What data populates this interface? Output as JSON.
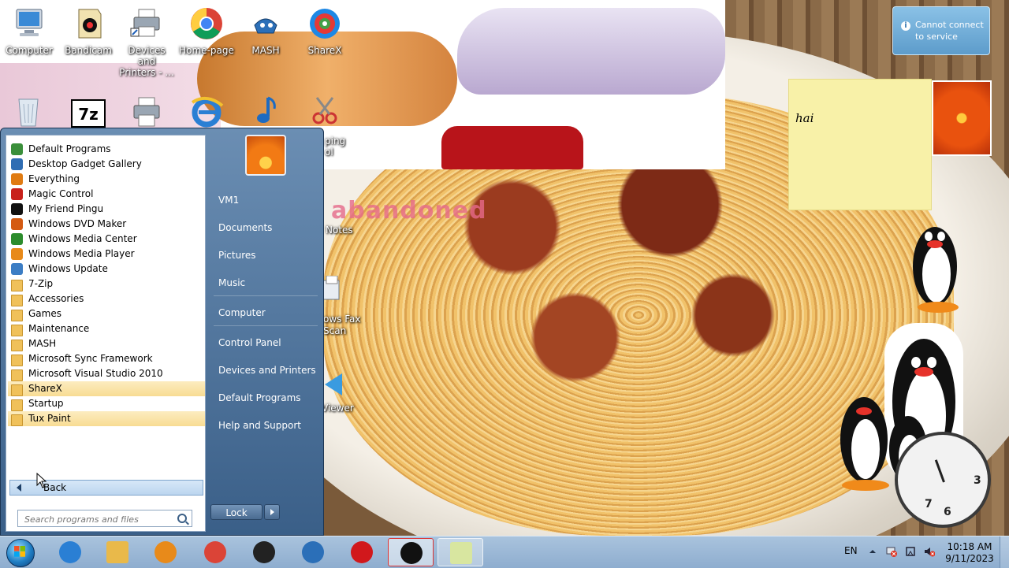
{
  "desktop": {
    "icons": [
      {
        "label": "Computer",
        "icon": "computer-icon"
      },
      {
        "label": "Bandicam",
        "icon": "bandicam-icon"
      },
      {
        "label": "Devices and Printers - ...",
        "icon": "printer-icon"
      },
      {
        "label": "Home-page",
        "icon": "chrome-icon"
      },
      {
        "label": "MASH",
        "icon": "mash-icon"
      },
      {
        "label": "ShareX",
        "icon": "sharex-icon"
      }
    ],
    "second_row_icons": [
      "recycle-bin-icon",
      "7zip-icon",
      "printer-icon",
      "internet-explorer-icon",
      "music-icon",
      "snipping-tool-icon"
    ],
    "partial_labels": {
      "snipping": "ping",
      "snipping2": "ol",
      "notes": "Notes",
      "fax": "ows Fax",
      "scan": "Scan",
      "viewer": "Viewer"
    },
    "wallpaper_watermark": "abandoned"
  },
  "gadgets": {
    "notification": {
      "line1": "Cannot connect",
      "line2": "to service"
    },
    "sticky_note": "hai",
    "clock_numbers": [
      "3",
      "6",
      "7"
    ]
  },
  "start_menu": {
    "programs": [
      {
        "label": "Default Programs",
        "icon": "default-programs-icon",
        "color": "#3a8f3a",
        "folder": false,
        "highlight": false
      },
      {
        "label": "Desktop Gadget Gallery",
        "icon": "gadget-gallery-icon",
        "color": "#2f6db3",
        "folder": false,
        "highlight": false
      },
      {
        "label": "Everything",
        "icon": "everything-search-icon",
        "color": "#e07b12",
        "folder": false,
        "highlight": false
      },
      {
        "label": "Magic Control",
        "icon": "magic-control-icon",
        "color": "#c8211b",
        "folder": false,
        "highlight": false
      },
      {
        "label": "My Friend Pingu",
        "icon": "pingu-icon",
        "color": "#111111",
        "folder": false,
        "highlight": false
      },
      {
        "label": "Windows DVD Maker",
        "icon": "dvd-maker-icon",
        "color": "#d45a12",
        "folder": false,
        "highlight": false
      },
      {
        "label": "Windows Media Center",
        "icon": "media-center-icon",
        "color": "#2c8c2c",
        "folder": false,
        "highlight": false
      },
      {
        "label": "Windows Media Player",
        "icon": "media-player-icon",
        "color": "#e88a1a",
        "folder": false,
        "highlight": false
      },
      {
        "label": "Windows Update",
        "icon": "windows-update-icon",
        "color": "#3c7dc4",
        "folder": false,
        "highlight": false
      },
      {
        "label": "7-Zip",
        "icon": "folder-icon",
        "folder": true,
        "highlight": false
      },
      {
        "label": "Accessories",
        "icon": "folder-icon",
        "folder": true,
        "highlight": false
      },
      {
        "label": "Games",
        "icon": "folder-icon",
        "folder": true,
        "highlight": false
      },
      {
        "label": "Maintenance",
        "icon": "folder-icon",
        "folder": true,
        "highlight": false
      },
      {
        "label": "MASH",
        "icon": "folder-icon",
        "folder": true,
        "highlight": false
      },
      {
        "label": "Microsoft Sync Framework",
        "icon": "folder-icon",
        "folder": true,
        "highlight": false
      },
      {
        "label": "Microsoft Visual Studio 2010",
        "icon": "folder-icon",
        "folder": true,
        "highlight": false
      },
      {
        "label": "ShareX",
        "icon": "folder-icon",
        "folder": true,
        "highlight": true
      },
      {
        "label": "Startup",
        "icon": "folder-icon",
        "folder": true,
        "highlight": false
      },
      {
        "label": "Tux Paint",
        "icon": "folder-icon",
        "folder": true,
        "highlight": true
      }
    ],
    "back_label": "Back",
    "search_placeholder": "Search programs and files",
    "right_links": [
      "VM1",
      "Documents",
      "Pictures",
      "Music",
      "Computer",
      "Control Panel",
      "Devices and Printers",
      "Default Programs",
      "Help and Support"
    ],
    "lock_label": "Lock"
  },
  "taskbar": {
    "buttons": [
      {
        "name": "internet-explorer",
        "icon": "internet-explorer-icon",
        "color": "#2a7fd4"
      },
      {
        "name": "file-explorer",
        "icon": "folder-icon",
        "color": "#e9b94a"
      },
      {
        "name": "media-player",
        "icon": "media-player-icon",
        "color": "#e88a1a"
      },
      {
        "name": "chrome",
        "icon": "chrome-icon",
        "color": "#db4437"
      },
      {
        "name": "tux-paint",
        "icon": "penguin-icon",
        "color": "#222222"
      },
      {
        "name": "mash",
        "icon": "mash-icon",
        "color": "#2b6fb8"
      },
      {
        "name": "record",
        "icon": "record-icon",
        "color": "#d1181c"
      },
      {
        "name": "pingu",
        "icon": "pingu-icon",
        "color": "#111111"
      },
      {
        "name": "sticky-notes",
        "icon": "sticky-notes-icon",
        "color": "#d8e6a0"
      }
    ],
    "language": "EN",
    "time": "10:18 AM",
    "date": "9/11/2023",
    "tray_icons": [
      "show-hidden-icons-icon",
      "network-error-icon",
      "action-center-icon",
      "volume-muted-icon"
    ]
  }
}
